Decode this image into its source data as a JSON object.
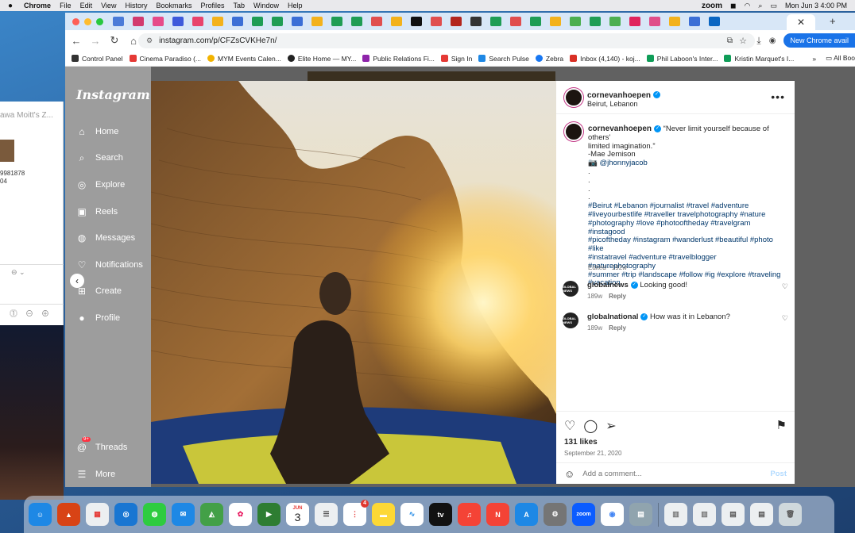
{
  "menubar": {
    "app": "Chrome",
    "items": [
      "File",
      "Edit",
      "View",
      "History",
      "Bookmarks",
      "Profiles",
      "Tab",
      "Window",
      "Help"
    ],
    "zoom": "zoom",
    "datetime": "Mon Jun 3  4:00 PM"
  },
  "left_window": {
    "title": "awa Moitt's Z...",
    "num1": "9981878",
    "num2": "04"
  },
  "browser": {
    "url": "instagram.com/p/CFZsCVKHe7n/",
    "new_chrome": "New Chrome avail",
    "bookmarks": [
      {
        "label": "Control Panel",
        "color": "#333"
      },
      {
        "label": "Cinema Paradiso (...",
        "color": "#e53935"
      },
      {
        "label": "MYM Events Calen...",
        "color": "#f2b300"
      },
      {
        "label": "Elite Home — MY...",
        "color": "#222"
      },
      {
        "label": "Public Relations Fi...",
        "color": "#8e24aa"
      },
      {
        "label": "Sign In",
        "color": "#e53935"
      },
      {
        "label": "Search Pulse",
        "color": "#1e88e5"
      },
      {
        "label": "Zebra",
        "color": "#1877f2"
      },
      {
        "label": "Inbox (4,140) - koj...",
        "color": "#d93025"
      },
      {
        "label": "Phil Laboon's Inter...",
        "color": "#0f9d58"
      },
      {
        "label": "Kristin Marquet's I...",
        "color": "#0f9d58"
      }
    ],
    "all_bookmarks": "All Boo"
  },
  "instagram": {
    "logo": "Instagram",
    "nav": [
      "Home",
      "Search",
      "Explore",
      "Reels",
      "Messages",
      "Notifications",
      "Create",
      "Profile",
      "Threads",
      "More"
    ],
    "threads_badge": "9+",
    "post": {
      "username": "cornevanhoepen",
      "location": "Beirut, Lebanon",
      "caption_lines": [
        "“Never limit yourself because of others'",
        "limited imagination.”",
        "-Mae Jemison",
        "📷 @jhonnyjacob",
        ".",
        ".",
        ".",
        ".",
        "#Beirut #Lebanon #journalist #travel #adventure",
        "#liveyourbestlife #traveller travelphotography #nature",
        "#photography #love #photooftheday #travelgram #instagood",
        "#picoftheday #instagram #wanderlust #beautiful #photo #like",
        "#instatravel #adventure #travelblogger #naturephotography",
        "#summer #trip #landscape #follow #ig #explore #traveling",
        "#vacation"
      ],
      "edited": "Edited · 192w",
      "comments": [
        {
          "user": "globalnews",
          "text": "Looking good!",
          "time": "189w",
          "reply": "Reply",
          "avatar_text": "GLOBAL NEWS"
        },
        {
          "user": "globalnational",
          "text": "How was it in Lebanon?",
          "time": "189w",
          "reply": "Reply",
          "avatar_text": "GLOBAL NEWS"
        }
      ],
      "likes": "131 likes",
      "date": "September 21, 2020",
      "comment_placeholder": "Add a comment...",
      "post_label": "Post"
    }
  },
  "dock": {
    "calendar_month": "JUN",
    "calendar_day": "3",
    "reminders_badge": "4",
    "tv_label": "tv",
    "zoom_label": "zoom"
  }
}
